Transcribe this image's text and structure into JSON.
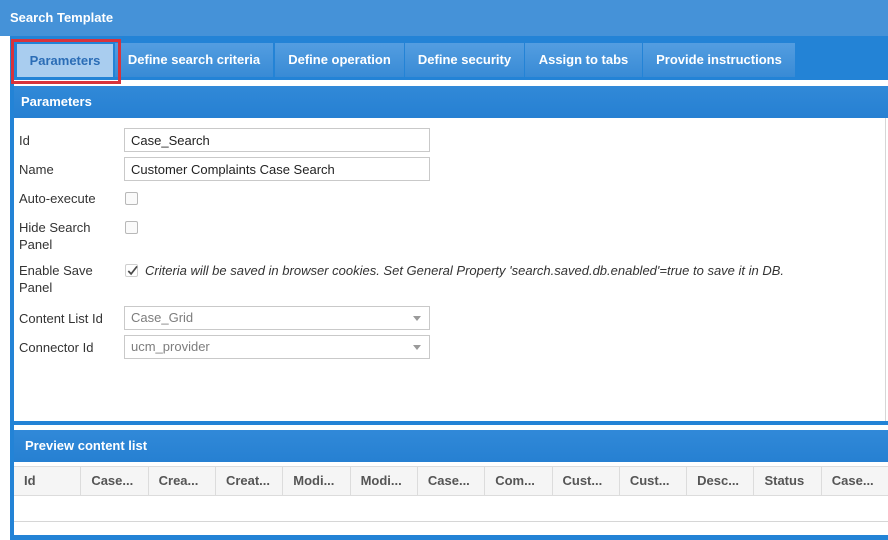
{
  "window": {
    "title": "Search Template"
  },
  "tabs": [
    {
      "label": "Parameters",
      "selected": true
    },
    {
      "label": "Define search criteria",
      "selected": false
    },
    {
      "label": "Define operation",
      "selected": false
    },
    {
      "label": "Define security",
      "selected": false
    },
    {
      "label": "Assign to tabs",
      "selected": false
    },
    {
      "label": "Provide instructions",
      "selected": false
    }
  ],
  "parameters": {
    "title": "Parameters",
    "id": {
      "label": "Id",
      "value": "Case_Search"
    },
    "name": {
      "label": "Name",
      "value": "Customer Complaints Case Search"
    },
    "auto_execute": {
      "label": "Auto-execute",
      "checked": false
    },
    "hide_search_panel": {
      "label": "Hide Search Panel",
      "checked": false
    },
    "enable_save_panel": {
      "label": "Enable Save Panel",
      "checked": true,
      "note": "Criteria will be saved in browser cookies. Set General Property 'search.saved.db.enabled'=true to save it in DB."
    },
    "content_list_id": {
      "label": "Content List Id",
      "value": "Case_Grid"
    },
    "connector_id": {
      "label": "Connector Id",
      "value": "ucm_provider"
    }
  },
  "preview": {
    "title": "Preview content list",
    "columns": [
      "Id",
      "Case...",
      "Crea...",
      "Creat...",
      "Modi...",
      "Modi...",
      "Case...",
      "Com...",
      "Cust...",
      "Cust...",
      "Desc...",
      "Status",
      "Case..."
    ]
  },
  "icons": {
    "checkbox_checked": "check-icon",
    "select_dropdown": "chevron-down-icon"
  },
  "colors": {
    "title_bar": "#4592d8",
    "tab_strip": "#2383d6",
    "tab": "#3a8fdc",
    "tab_selected": "#a9cdef",
    "tab_selected_text": "#2b6db6",
    "panel_header": "#2680d2",
    "highlight": "#d8333b"
  }
}
